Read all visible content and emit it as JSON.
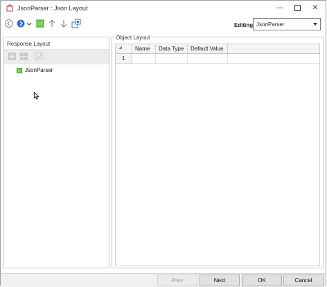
{
  "window": {
    "title": "JsonParser : Json Layout",
    "controls": [
      "minimize-icon",
      "maximize-icon",
      "close-icon"
    ]
  },
  "toolbar": {
    "icons": [
      "back-circle-icon",
      "forward-circle-icon",
      "dropdown-caret-icon",
      "green-square-icon",
      "arrow-up-icon",
      "arrow-down-icon",
      "layout-icon"
    ],
    "editing_label": "Editing:",
    "editing_value": "JsonParser"
  },
  "response_layout": {
    "title": "Response Layout",
    "mini_toolbar_icons": [
      "add-node-icon",
      "grid-node-icon",
      "edit-node-icon"
    ],
    "tree": [
      {
        "label": "JsonParser",
        "icon": "green-square-icon"
      }
    ]
  },
  "object_layout": {
    "title": "Object Layout",
    "columns": [
      "Name",
      "Data Type",
      "Default Value"
    ],
    "rows": [
      {
        "index": "1",
        "name": "",
        "data_type": "",
        "default_value": ""
      }
    ]
  },
  "footer": {
    "prev": "Prev",
    "next": "Next",
    "ok": "OK",
    "cancel": "Cancel"
  },
  "colors": {
    "accent_green": "#7dd35a",
    "accent_blue": "#2f6fd1",
    "button_face": "#e1e1e1"
  }
}
